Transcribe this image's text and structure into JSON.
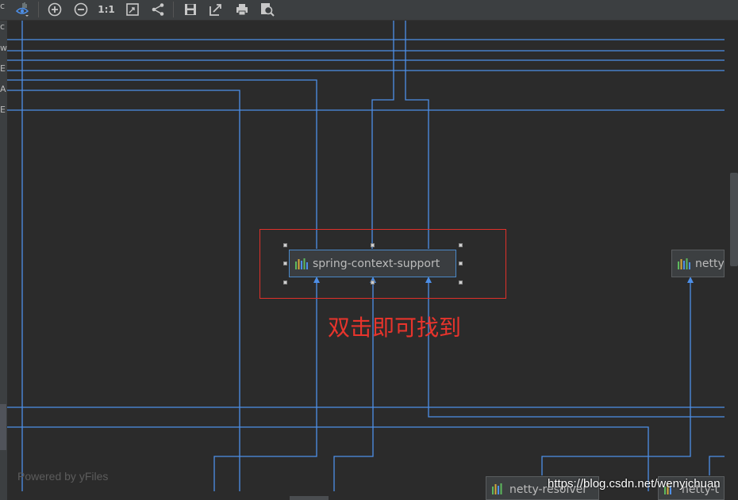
{
  "toolbar": {
    "items": [
      {
        "icon": "eye-icon"
      },
      {
        "icon": "zoom-in-icon"
      },
      {
        "icon": "zoom-out-icon"
      },
      {
        "icon": "actual-size-icon",
        "label": "1:1"
      },
      {
        "icon": "fit-content-icon"
      },
      {
        "icon": "layout-icon"
      },
      {
        "icon": "save-icon"
      },
      {
        "icon": "export-icon"
      },
      {
        "icon": "print-icon"
      },
      {
        "icon": "print-preview-icon"
      }
    ]
  },
  "left_edge": {
    "chars": [
      "c",
      "c",
      "w",
      "E",
      "A",
      "E"
    ]
  },
  "nodes": {
    "main": {
      "label": "spring-context-support",
      "selected": true
    },
    "right": {
      "label": "netty"
    },
    "bottom_left": {
      "label": "netty-resolver"
    },
    "bottom_right": {
      "label": "netty-t"
    }
  },
  "annotation": {
    "text": "双击即可找到",
    "color": "#e8342c"
  },
  "footer": {
    "powered_by": "Powered by yFiles",
    "watermark": "https://blog.csdn.net/wenyichuan"
  },
  "colors": {
    "background": "#2b2b2b",
    "edge": "#4d8fe8",
    "node_fill": "#3c3f41",
    "highlight_box": "#e0302a"
  }
}
